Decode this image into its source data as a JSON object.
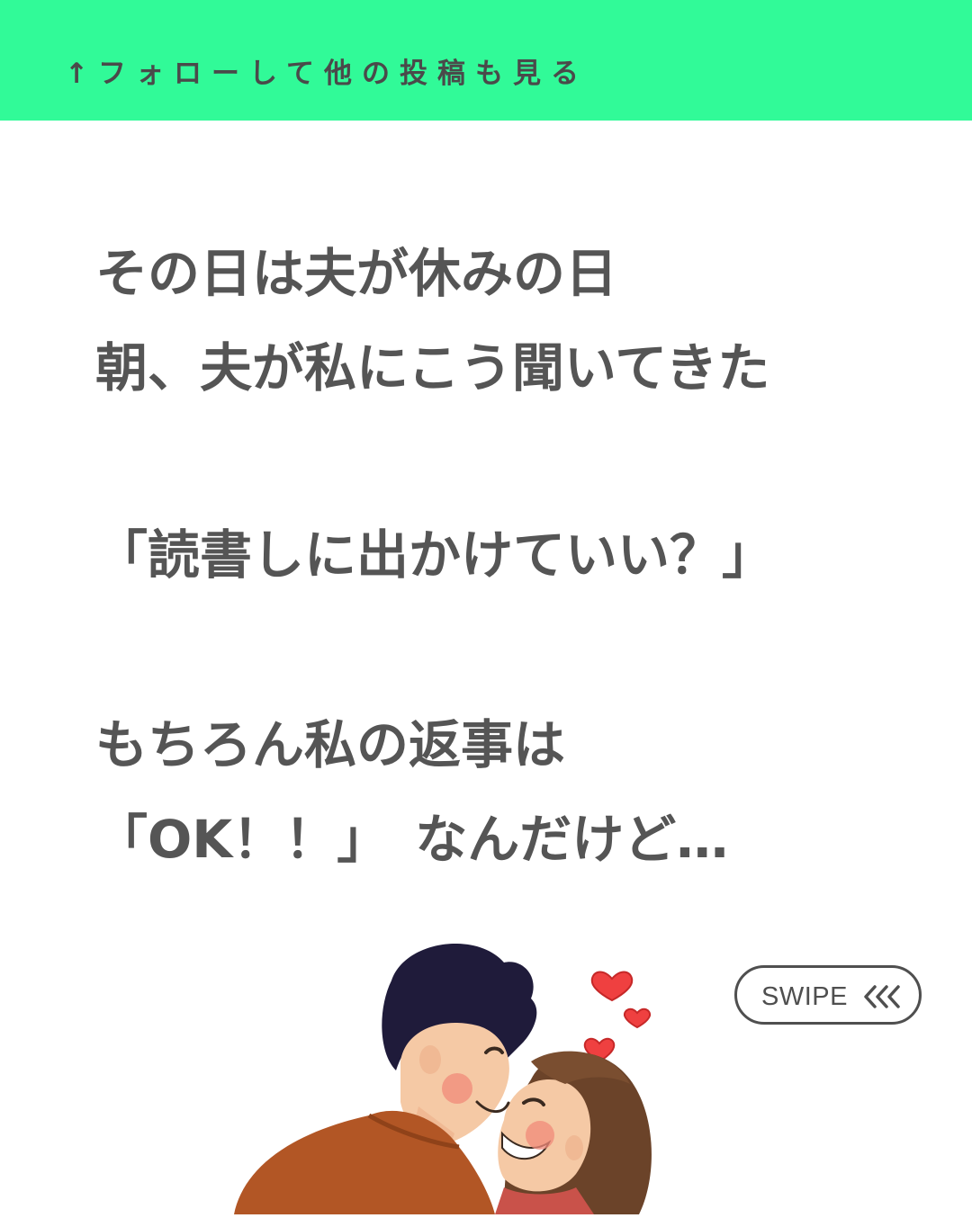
{
  "banner": {
    "text": "↑フォローして他の投稿も見る",
    "color": "#31fa98"
  },
  "story": {
    "line1": "その日は夫が休みの日",
    "line2": "朝、夫が私にこう聞いてきた",
    "line3": "「読書しに出かけていい？」",
    "line4": "もちろん私の返事は",
    "line5": "「OK！！」　なんだけど…"
  },
  "swipe": {
    "label": "SWIPE",
    "icon": "triple-chevron-left-icon"
  },
  "illustration": {
    "icon": "kissing-couple-with-hearts-illustration"
  }
}
